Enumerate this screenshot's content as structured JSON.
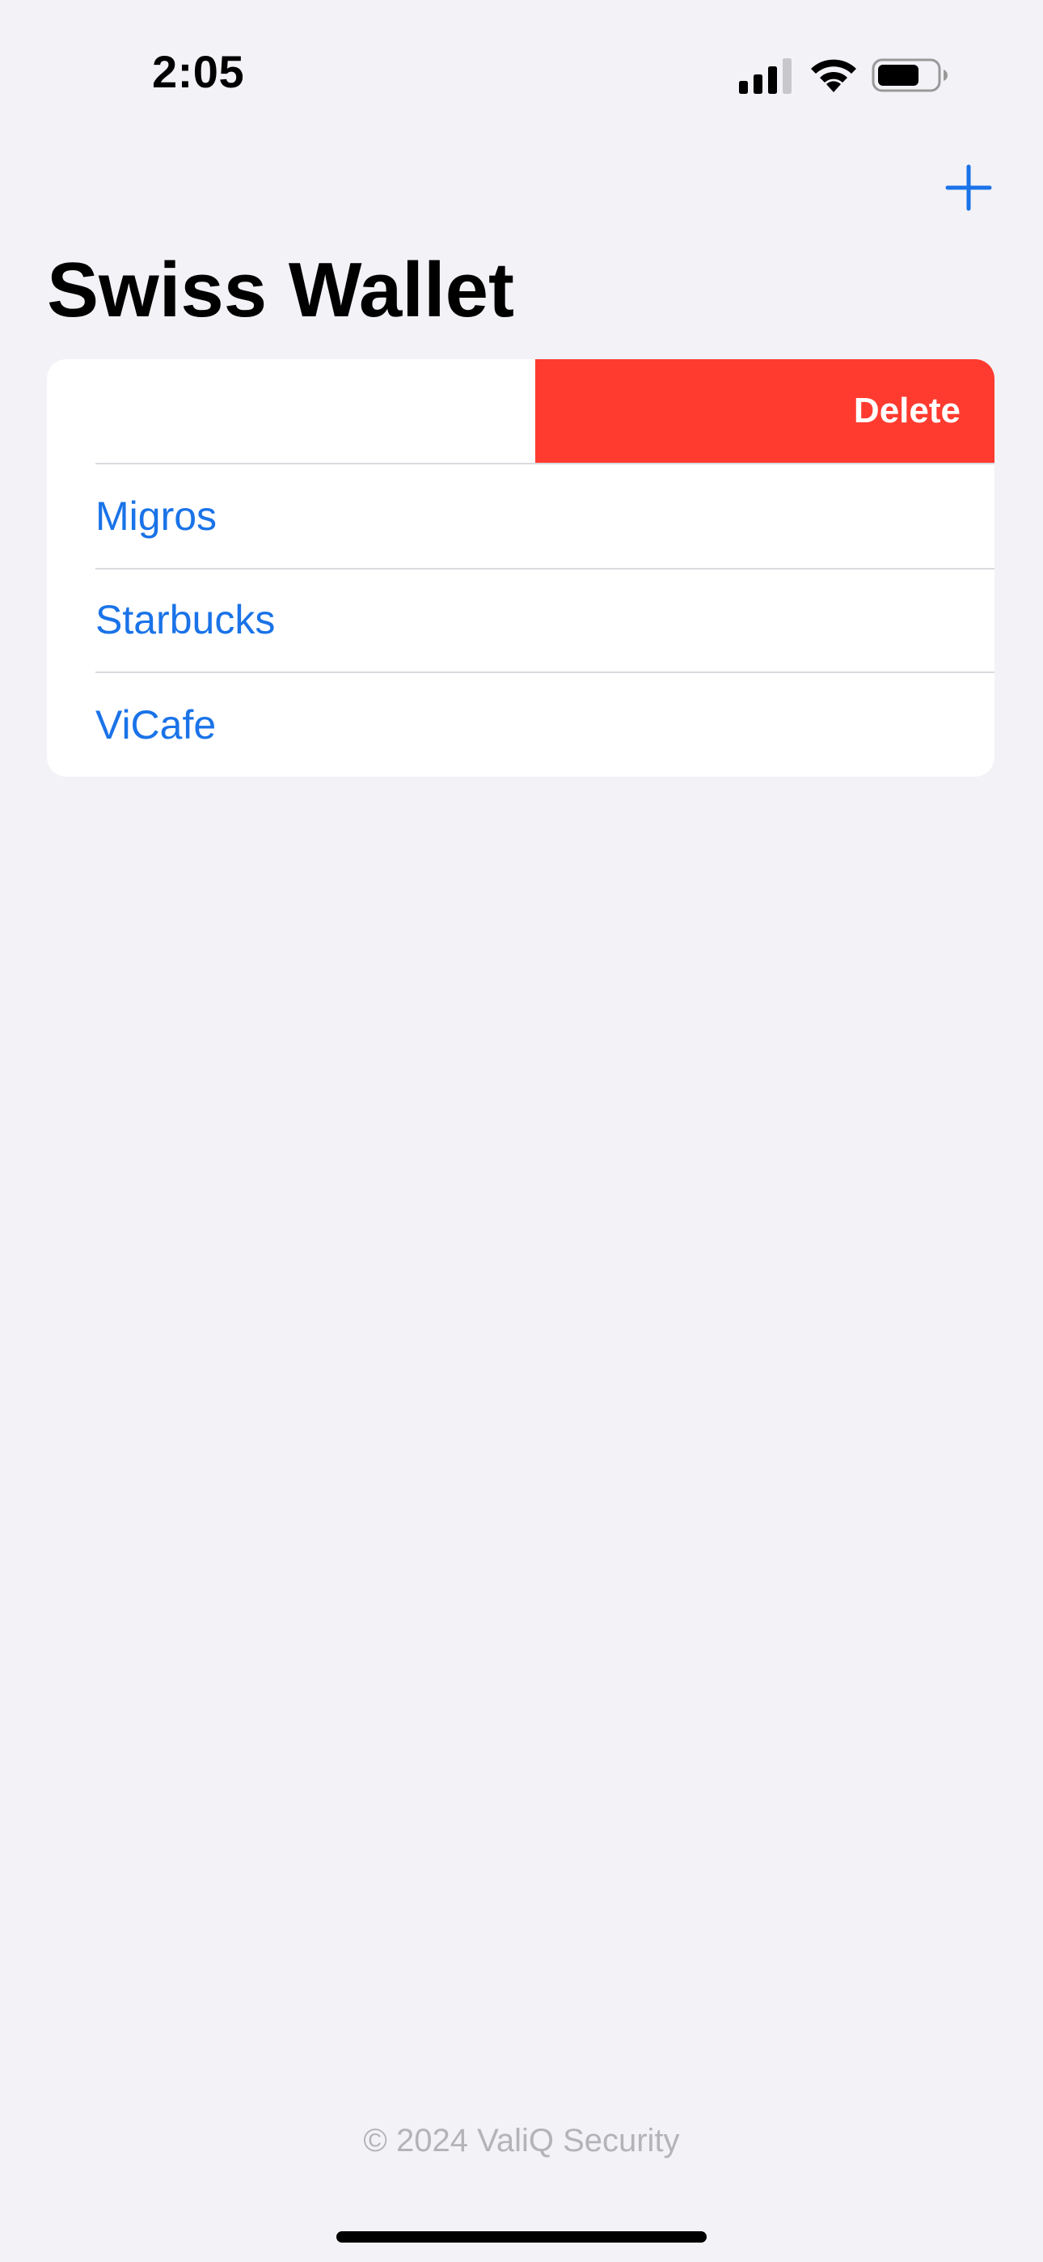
{
  "status_bar": {
    "time": "2:05",
    "icons": [
      "cellular-signal-icon",
      "wifi-icon",
      "battery-icon"
    ]
  },
  "nav": {
    "add_icon": "plus-icon",
    "title": "Swiss Wallet"
  },
  "list": {
    "swiped_row": {
      "label": "",
      "action_label": "Delete"
    },
    "items": [
      {
        "label": "Migros"
      },
      {
        "label": "Starbucks"
      },
      {
        "label": "ViCafe"
      }
    ]
  },
  "footer": {
    "text": "© 2024 ValiQ Security"
  },
  "colors": {
    "background": "#F2F2F7",
    "accent": "#1A73E8",
    "destructive": "#FF3B30",
    "card": "#FFFFFF"
  }
}
